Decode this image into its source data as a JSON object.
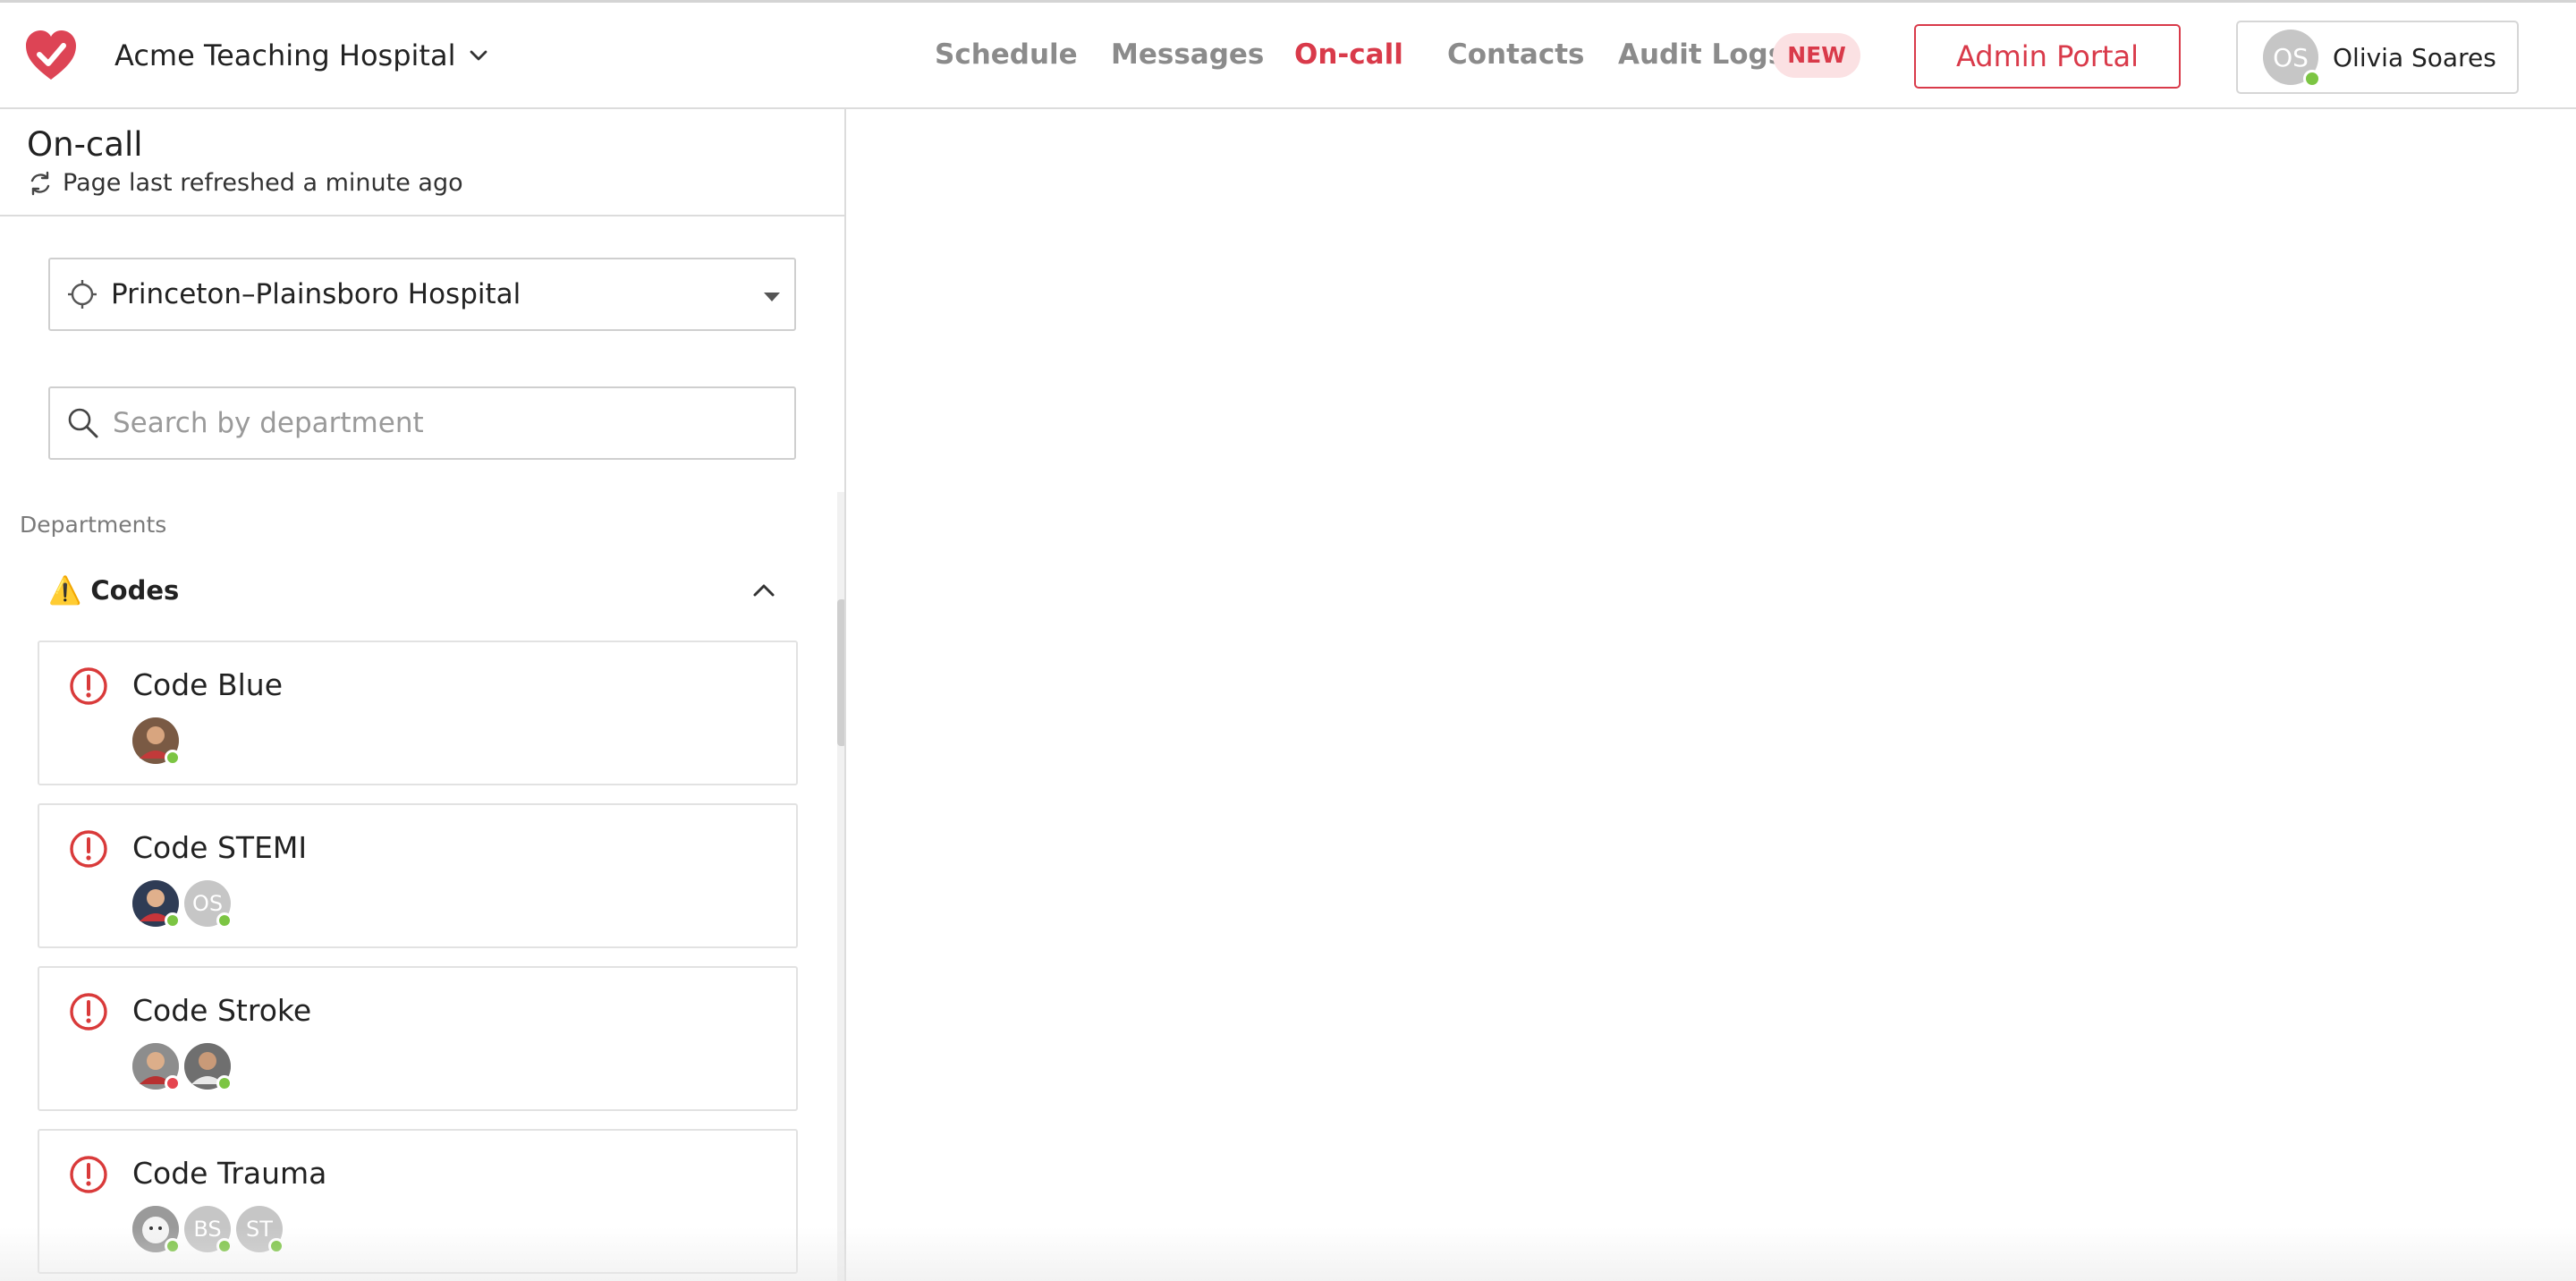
{
  "header": {
    "org_name": "Acme Teaching Hospital",
    "nav": [
      {
        "label": "Schedule"
      },
      {
        "label": "Messages"
      },
      {
        "label": "On-call"
      },
      {
        "label": "Contacts"
      },
      {
        "label": "Audit Logs"
      }
    ],
    "active_nav": "On-call",
    "new_badge": "NEW",
    "admin_portal": "Admin Portal",
    "user": {
      "initials": "OS",
      "name": "Olivia Soares",
      "status": "online"
    }
  },
  "panel": {
    "title": "On-call",
    "refresh_text": "Page last refreshed a minute ago",
    "location": "Princeton–Plainsboro Hospital",
    "search_placeholder": "Search by department",
    "departments_label": "Departments",
    "group": {
      "emoji": "⚠️",
      "name": "Codes",
      "expanded": true
    },
    "cards": [
      {
        "title": "Code Blue",
        "avatars": [
          {
            "type": "photo",
            "status": "online"
          }
        ]
      },
      {
        "title": "Code STEMI",
        "avatars": [
          {
            "type": "photo",
            "status": "online"
          },
          {
            "type": "initials",
            "initials": "OS",
            "status": "online"
          }
        ]
      },
      {
        "title": "Code Stroke",
        "avatars": [
          {
            "type": "photo",
            "status": "busy"
          },
          {
            "type": "photo",
            "status": "online"
          }
        ]
      },
      {
        "title": "Code Trauma",
        "avatars": [
          {
            "type": "photo",
            "status": "online"
          },
          {
            "type": "initials",
            "initials": "BS",
            "status": "online"
          },
          {
            "type": "initials",
            "initials": "ST",
            "status": "online"
          }
        ]
      }
    ]
  },
  "colors": {
    "accent": "#d93a4a",
    "online": "#7cc543",
    "busy": "#e5454f",
    "badge_bg": "#fbe1e3"
  }
}
